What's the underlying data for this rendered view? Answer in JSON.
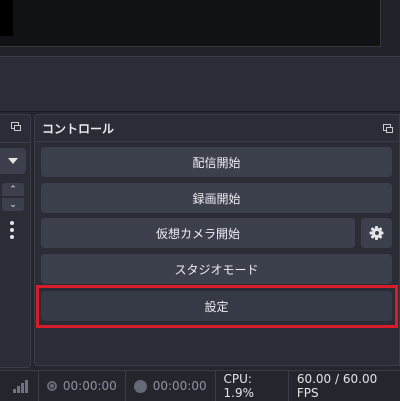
{
  "controls": {
    "title": "コントロール",
    "start_streaming": "配信開始",
    "start_recording": "録画開始",
    "start_virtual_camera": "仮想カメラ開始",
    "studio_mode": "スタジオモード",
    "settings": "設定"
  },
  "status": {
    "stream_time": "00:00:00",
    "record_time": "00:00:00",
    "cpu": "CPU: 1.9%",
    "fps": "60.00 / 60.00 FPS"
  },
  "colors": {
    "highlight": "#d81c2a",
    "button_bg": "#3c3f4c",
    "dock_bg": "#2b2d36"
  }
}
